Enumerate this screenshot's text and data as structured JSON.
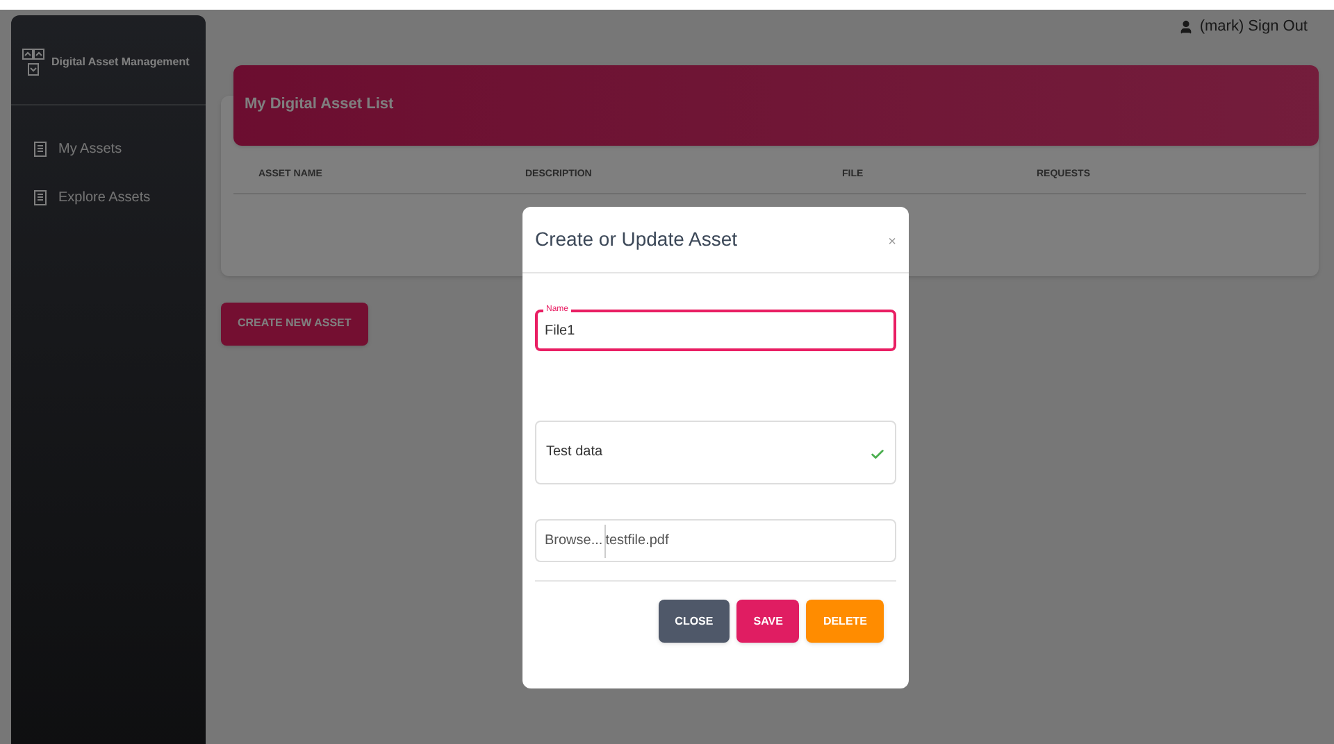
{
  "user_menu": {
    "label": "(mark) Sign Out"
  },
  "sidebar": {
    "brand": "Digital Asset Management",
    "items": [
      {
        "label": "My Assets",
        "selected": false
      },
      {
        "label": "Explore Assets",
        "selected": false
      }
    ]
  },
  "card": {
    "title": "My Digital Asset List",
    "columns": [
      "ASSET NAME",
      "DESCRIPTION",
      "FILE",
      "REQUESTS"
    ]
  },
  "create_button": "CREATE NEW ASSET",
  "dialog": {
    "title": "Create or Update Asset",
    "close": "×",
    "name_field": {
      "label": "Name",
      "value": "File1",
      "focused": true
    },
    "description_field": {
      "value": "Test data",
      "valid": true
    },
    "file_field": {
      "button": "Browse...",
      "value": "testfile.pdf"
    },
    "buttons": [
      {
        "label": "CLOSE",
        "kind": "close"
      },
      {
        "label": "SAVE",
        "kind": "save"
      },
      {
        "label": "DELETE",
        "kind": "delete"
      }
    ]
  }
}
